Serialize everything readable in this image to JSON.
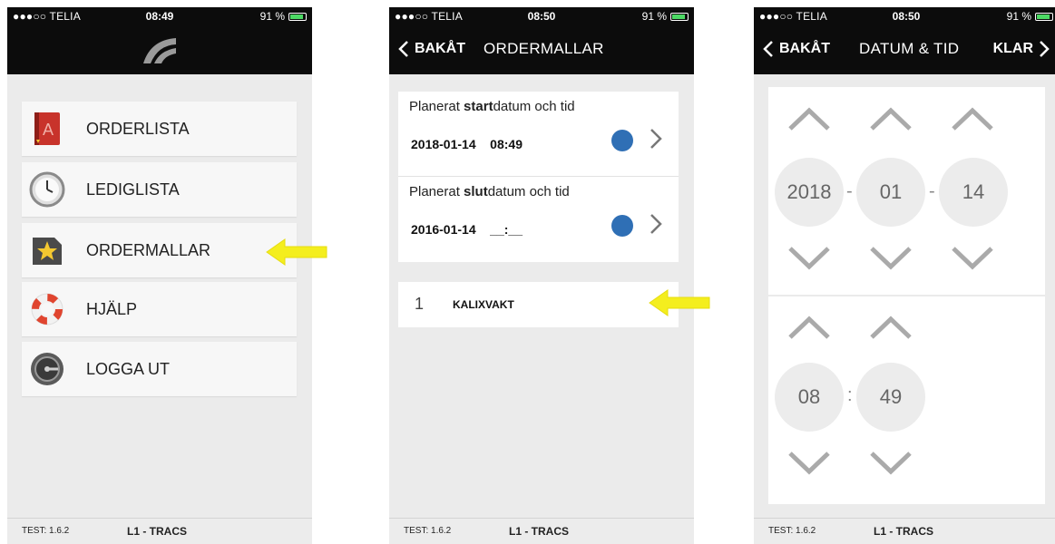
{
  "colors": {
    "bar": "#0c0c0c",
    "background": "#ebebeb",
    "panel": "#ffffff",
    "selector": "#2f6fb5",
    "arrow": "#f4ee1e"
  },
  "screen1": {
    "status": {
      "carrier": "●●●○○ TELIA",
      "time": "08:49",
      "right": "91 %"
    },
    "menu": [
      {
        "label": "ORDERLISTA",
        "icon": "book-icon"
      },
      {
        "label": "LEDIGLISTA",
        "icon": "clock-icon"
      },
      {
        "label": "ORDERMALLAR",
        "icon": "star-folder-icon"
      },
      {
        "label": "HJÄLP",
        "icon": "lifebuoy-icon"
      },
      {
        "label": "LOGGA UT",
        "icon": "safe-lock-icon"
      }
    ],
    "footer": {
      "version": "TEST: 1.6.2",
      "line": "L1 - TRACS"
    }
  },
  "screen2": {
    "status": {
      "carrier": "●●●○○ TELIA",
      "time": "08:50",
      "right": "91 %"
    },
    "nav": {
      "back": "BAKÅT",
      "title": "ORDERMALLAR"
    },
    "start": {
      "prefix": "Planerat ",
      "bold": "start",
      "suffix": "datum och tid",
      "value": "2018-01-14    08:49"
    },
    "end": {
      "prefix": "Planerat ",
      "bold": "slut",
      "suffix": "datum och tid",
      "value": "2016-01-14    __:__"
    },
    "template": {
      "index": "1",
      "name": "KALIXVAKT"
    },
    "footer": {
      "version": "TEST: 1.6.2",
      "line": "L1 - TRACS"
    }
  },
  "screen3": {
    "status": {
      "carrier": "●●●○○ TELIA",
      "time": "08:50",
      "right": "91 %"
    },
    "nav": {
      "back": "BAKÅT",
      "title": "DATUM & TID",
      "done": "KLAR"
    },
    "date": {
      "year": "2018",
      "month": "01",
      "day": "14",
      "sep": "-"
    },
    "time": {
      "hour": "08",
      "minute": "49",
      "sep": ":"
    },
    "footer": {
      "version": "TEST: 1.6.2",
      "line": "L1 - TRACS"
    }
  }
}
